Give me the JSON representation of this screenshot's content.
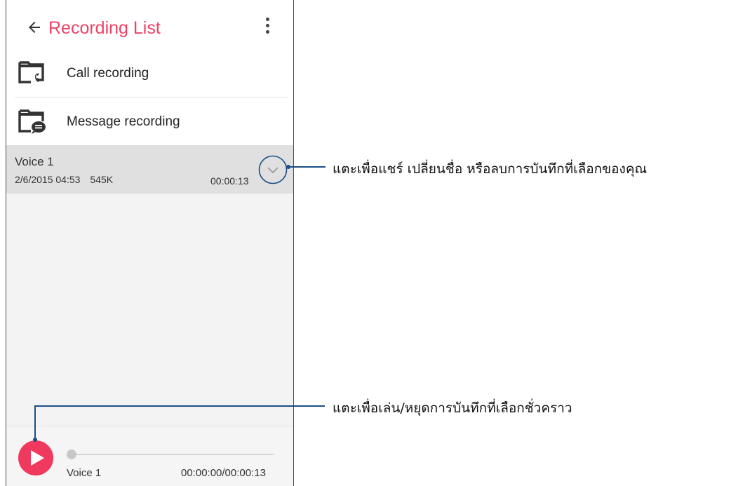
{
  "appbar": {
    "title": "Recording List",
    "back_icon": "arrow-left-icon",
    "menu_icon": "more-vert-icon"
  },
  "folders": [
    {
      "label": "Call recording",
      "icon": "call-folder-icon"
    },
    {
      "label": "Message recording",
      "icon": "message-folder-icon"
    }
  ],
  "recordings": [
    {
      "name": "Voice 1",
      "date": "2/6/2015 04:53",
      "size": "545K",
      "duration": "00:00:13",
      "expand_icon": "chevron-down-icon"
    }
  ],
  "player": {
    "name": "Voice 1",
    "time": "00:00:00/00:00:13",
    "progress": 0.0,
    "play_icon": "play-icon"
  },
  "callouts": {
    "expand": "แตะเพื่อแชร์ เปลี่ยนชื่อ หรือลบการบันทึกที่เลือกของคุณ",
    "play": "แตะเพื่อเล่น/หยุดการบันทึกที่เลือกชั่วคราว"
  },
  "colors": {
    "accent": "#ee4266",
    "play_button": "#f0395e",
    "callout": "#1b4f86",
    "selected_row": "#e0e0e0"
  }
}
